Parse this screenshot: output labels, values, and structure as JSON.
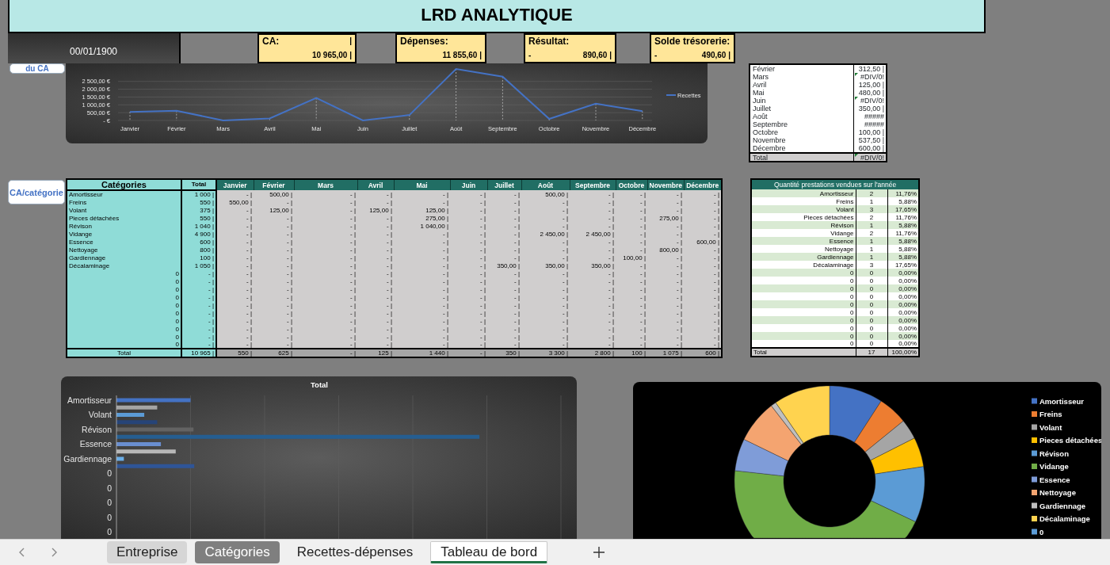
{
  "title": "LRD ANALYTIQUE",
  "date": "00/01/1900",
  "kpis": [
    {
      "label": "CA:",
      "mark": "|",
      "value": "10 965,00 |"
    },
    {
      "label": "Dépenses:",
      "value": "11 855,60 |"
    },
    {
      "label": "Résultat:",
      "sign": "-",
      "value": "890,60 |"
    },
    {
      "label": "Solde trésorerie:",
      "sign": "-",
      "value": "490,60 |"
    }
  ],
  "chart_button": {
    "label": "du CA"
  },
  "line_chart": {
    "chart_data": {
      "type": "line",
      "categories": [
        "Janvier",
        "Février",
        "Mars",
        "Avril",
        "Mai",
        "Juin",
        "Juillet",
        "Août",
        "Septembre",
        "Octobre",
        "Novembre",
        "Décembre"
      ],
      "series": [
        {
          "name": "Recettes",
          "color": "#4472c4",
          "values": [
            550,
            625,
            0,
            125,
            1440,
            0,
            350,
            3300,
            2800,
            100,
            1075,
            600
          ]
        }
      ],
      "ylim": [
        0,
        3400
      ],
      "grid": true,
      "yticks": [
        {
          "value": 0,
          "label": "- €"
        },
        {
          "value": 500,
          "label": "500,00 €"
        },
        {
          "value": 1000,
          "label": "1 000,00 €"
        },
        {
          "value": 1500,
          "label": "1 500,00 €"
        },
        {
          "value": 2000,
          "label": "2 000,00 €"
        },
        {
          "value": 2500,
          "label": "2 500,00 €"
        }
      ]
    }
  },
  "monthly_average": {
    "rows": [
      {
        "month": "Février",
        "value": "312,50 |",
        "flagged": false
      },
      {
        "month": "Mars",
        "value": "#DIV/0!",
        "flagged": true
      },
      {
        "month": "Avril",
        "value": "125,00 |",
        "flagged": false
      },
      {
        "month": "Mai",
        "value": "480,00 |",
        "flagged": false
      },
      {
        "month": "Juin",
        "value": "#DIV/0!",
        "flagged": true
      },
      {
        "month": "Juillet",
        "value": "350,00 |",
        "flagged": false
      },
      {
        "month": "Août",
        "value": "#####",
        "flagged": false
      },
      {
        "month": "Septembre",
        "value": "#####",
        "flagged": false
      },
      {
        "month": "Octobre",
        "value": "100,00 |",
        "flagged": false
      },
      {
        "month": "Novembre",
        "value": "537,50 |",
        "flagged": false
      },
      {
        "month": "Décembre",
        "value": "600,00 |",
        "flagged": false
      }
    ],
    "total": {
      "month": "Total",
      "value": "#DIV/0!",
      "flagged": true
    }
  },
  "table_button": {
    "label": "CA/catégorie"
  },
  "categories_table": {
    "unit_mark": "|",
    "columns": [
      "Catégories",
      "Total",
      "Janvier",
      "Février",
      "Mars",
      "Avril",
      "Mai",
      "Juin",
      "Juillet",
      "Août",
      "Septembre",
      "Octobre",
      "Novembre",
      "Décembre"
    ],
    "rows": [
      {
        "label": "Amortisseur",
        "total": "1 000",
        "months": [
          "-",
          "500,00",
          "-",
          "-",
          "-",
          "-",
          "-",
          "500,00",
          "-",
          "-",
          "-",
          "-"
        ]
      },
      {
        "label": "Freins",
        "total": "550",
        "months": [
          "550,00",
          "-",
          "-",
          "-",
          "-",
          "-",
          "-",
          "-",
          "-",
          "-",
          "-",
          "-"
        ]
      },
      {
        "label": "Volant",
        "total": "375",
        "months": [
          "-",
          "125,00",
          "-",
          "125,00",
          "125,00",
          "-",
          "-",
          "-",
          "-",
          "-",
          "-",
          "-"
        ]
      },
      {
        "label": "Pieces détachées",
        "total": "550",
        "months": [
          "-",
          "-",
          "-",
          "-",
          "275,00",
          "-",
          "-",
          "-",
          "-",
          "-",
          "275,00",
          "-"
        ]
      },
      {
        "label": "Révison",
        "total": "1 040",
        "months": [
          "-",
          "-",
          "-",
          "-",
          "1 040,00",
          "-",
          "-",
          "-",
          "-",
          "-",
          "-",
          "-"
        ]
      },
      {
        "label": "Vidange",
        "total": "4 900",
        "months": [
          "-",
          "-",
          "-",
          "-",
          "-",
          "-",
          "-",
          "2 450,00",
          "2 450,00",
          "-",
          "-",
          "-"
        ]
      },
      {
        "label": "Essence",
        "total": "600",
        "months": [
          "-",
          "-",
          "-",
          "-",
          "-",
          "-",
          "-",
          "-",
          "-",
          "-",
          "-",
          "600,00"
        ]
      },
      {
        "label": "Nettoyage",
        "total": "800",
        "months": [
          "-",
          "-",
          "-",
          "-",
          "-",
          "-",
          "-",
          "-",
          "-",
          "-",
          "800,00",
          "-"
        ]
      },
      {
        "label": "Gardiennage",
        "total": "100",
        "months": [
          "-",
          "-",
          "-",
          "-",
          "-",
          "-",
          "-",
          "-",
          "-",
          "100,00",
          "-",
          "-"
        ]
      },
      {
        "label": "Décalaminage",
        "total": "1 050",
        "months": [
          "-",
          "-",
          "-",
          "-",
          "-",
          "-",
          "350,00",
          "350,00",
          "350,00",
          "-",
          "-",
          "-"
        ]
      },
      {
        "label": "0",
        "total": "-",
        "months": [
          "-",
          "-",
          "-",
          "-",
          "-",
          "-",
          "-",
          "-",
          "-",
          "-",
          "-",
          "-"
        ]
      },
      {
        "label": "0",
        "total": "-",
        "months": [
          "-",
          "-",
          "-",
          "-",
          "-",
          "-",
          "-",
          "-",
          "-",
          "-",
          "-",
          "-"
        ]
      },
      {
        "label": "0",
        "total": "-",
        "months": [
          "-",
          "-",
          "-",
          "-",
          "-",
          "-",
          "-",
          "-",
          "-",
          "-",
          "-",
          "-"
        ]
      },
      {
        "label": "0",
        "total": "-",
        "months": [
          "-",
          "-",
          "-",
          "-",
          "-",
          "-",
          "-",
          "-",
          "-",
          "-",
          "-",
          "-"
        ]
      },
      {
        "label": "0",
        "total": "-",
        "months": [
          "-",
          "-",
          "-",
          "-",
          "-",
          "-",
          "-",
          "-",
          "-",
          "-",
          "-",
          "-"
        ]
      },
      {
        "label": "0",
        "total": "-",
        "months": [
          "-",
          "-",
          "-",
          "-",
          "-",
          "-",
          "-",
          "-",
          "-",
          "-",
          "-",
          "-"
        ]
      },
      {
        "label": "0",
        "total": "-",
        "months": [
          "-",
          "-",
          "-",
          "-",
          "-",
          "-",
          "-",
          "-",
          "-",
          "-",
          "-",
          "-"
        ]
      },
      {
        "label": "0",
        "total": "-",
        "months": [
          "-",
          "-",
          "-",
          "-",
          "-",
          "-",
          "-",
          "-",
          "-",
          "-",
          "-",
          "-"
        ]
      },
      {
        "label": "0",
        "total": "-",
        "months": [
          "-",
          "-",
          "-",
          "-",
          "-",
          "-",
          "-",
          "-",
          "-",
          "-",
          "-",
          "-"
        ]
      },
      {
        "label": "0",
        "total": "-",
        "months": [
          "-",
          "-",
          "-",
          "-",
          "-",
          "-",
          "-",
          "-",
          "-",
          "-",
          "-",
          "-"
        ]
      }
    ],
    "total_row": {
      "label": "Total",
      "total": "10 965",
      "months": [
        "550",
        "625",
        "-",
        "125",
        "1 440",
        "-",
        "350",
        "3 300",
        "2 800",
        "100",
        "1 075",
        "600"
      ]
    }
  },
  "quantity_table": {
    "title": "Quantité prestations vendues sur l'année",
    "rows": [
      {
        "label": "Amortisseur",
        "count": "2",
        "share": "11,76%"
      },
      {
        "label": "Freins",
        "count": "1",
        "share": "5,88%"
      },
      {
        "label": "Volant",
        "count": "3",
        "share": "17,65%"
      },
      {
        "label": "Pieces détachées",
        "count": "2",
        "share": "11,76%"
      },
      {
        "label": "Révison",
        "count": "1",
        "share": "5,88%"
      },
      {
        "label": "Vidange",
        "count": "2",
        "share": "11,76%"
      },
      {
        "label": "Essence",
        "count": "1",
        "share": "5,88%"
      },
      {
        "label": "Nettoyage",
        "count": "1",
        "share": "5,88%"
      },
      {
        "label": "Gardiennage",
        "count": "1",
        "share": "5,88%"
      },
      {
        "label": "Décalaminage",
        "count": "3",
        "share": "17,65%"
      },
      {
        "label": "0",
        "count": "0",
        "share": "0,00%"
      },
      {
        "label": "0",
        "count": "0",
        "share": "0,00%"
      },
      {
        "label": "0",
        "count": "0",
        "share": "0,00%"
      },
      {
        "label": "0",
        "count": "0",
        "share": "0,00%"
      },
      {
        "label": "0",
        "count": "0",
        "share": "0,00%"
      },
      {
        "label": "0",
        "count": "0",
        "share": "0,00%"
      },
      {
        "label": "0",
        "count": "0",
        "share": "0,00%"
      },
      {
        "label": "0",
        "count": "0",
        "share": "0,00%"
      },
      {
        "label": "0",
        "count": "0",
        "share": "0,00%"
      },
      {
        "label": "0",
        "count": "0",
        "share": "0,00%"
      }
    ],
    "total": {
      "label": "Total",
      "count": "17",
      "share": "100,00%"
    }
  },
  "bar_chart": {
    "title": "Total",
    "axis_labels": [
      "Amortisseur",
      "Volant",
      "Révison",
      "Essence",
      "Gardiennage",
      "0",
      "0",
      "0",
      "0",
      "0"
    ]
  },
  "donut_legend": [
    {
      "label": "Amortisseur",
      "color": "#4472c4"
    },
    {
      "label": "Freins",
      "color": "#ed7d31"
    },
    {
      "label": "Volant",
      "color": "#a5a5a5"
    },
    {
      "label": "Pieces détachées",
      "color": "#ffc000"
    },
    {
      "label": "Révison",
      "color": "#5b9bd5"
    },
    {
      "label": "Vidange",
      "color": "#70ad47"
    },
    {
      "label": "Essence",
      "color": "#7f9cd8"
    },
    {
      "label": "Nettoyage",
      "color": "#f4a470"
    },
    {
      "label": "Gardiennage",
      "color": "#bfbfbf"
    },
    {
      "label": "Décalaminage",
      "color": "#ffd34f"
    },
    {
      "label": "0",
      "color": "#5b9bd5"
    }
  ],
  "sheet_tabs": [
    {
      "label": "Entreprise",
      "color": "#d6d6d6",
      "selected": false
    },
    {
      "label": "Catégories",
      "color": "#7f7f7f",
      "selected": false
    },
    {
      "label": "Recettes-dépenses",
      "selected": false
    },
    {
      "label": "Tableau de bord",
      "selected": true
    }
  ]
}
